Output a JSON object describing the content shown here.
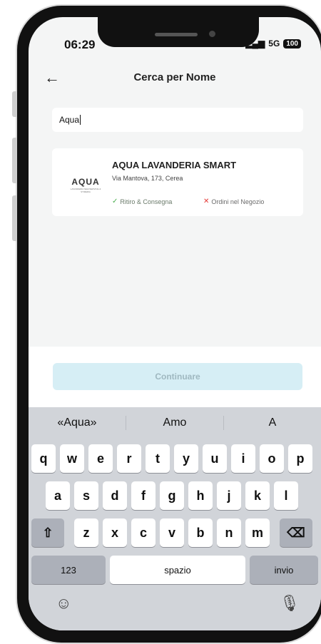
{
  "status": {
    "time": "06:29",
    "network": "5G",
    "battery": "100"
  },
  "header": {
    "back_icon": "arrow-left-icon",
    "title": "Cerca per Nome"
  },
  "search": {
    "value": "Aqua"
  },
  "result": {
    "logo_text": "AQUA",
    "logo_subtext": "LAVANDERIA SELFSERVICE & STIRERIA",
    "name": "AQUA LAVANDERIA SMART",
    "address": "Via Mantova, 173, Cerea",
    "feature_ok": "Ritiro & Consegna",
    "feature_no": "Ordini nel Negozio"
  },
  "continue_label": "Continuare",
  "keyboard": {
    "suggestions": [
      "«Aqua»",
      "Amo",
      "A"
    ],
    "row1": [
      "q",
      "w",
      "e",
      "r",
      "t",
      "y",
      "u",
      "i",
      "o",
      "p"
    ],
    "row2": [
      "a",
      "s",
      "d",
      "f",
      "g",
      "h",
      "j",
      "k",
      "l"
    ],
    "row3": [
      "z",
      "x",
      "c",
      "v",
      "b",
      "n",
      "m"
    ],
    "numbers_label": "123",
    "space_label": "spazio",
    "return_label": "invio"
  },
  "colors": {
    "accent_button": "#d6eef5",
    "check": "#4caf50",
    "cross": "#e53935"
  }
}
